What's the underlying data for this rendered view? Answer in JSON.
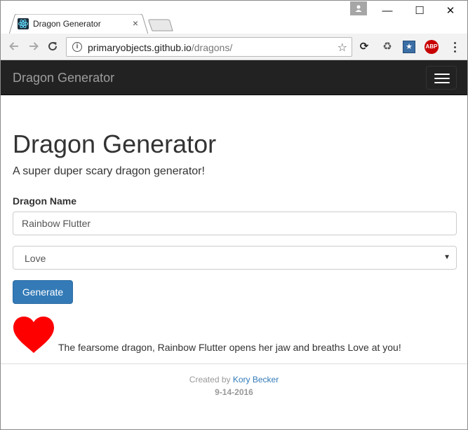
{
  "browser": {
    "tab_title": "Dragon Generator",
    "tab_close": "×",
    "url_host": "primaryobjects.github.io",
    "url_path": "/dragons/",
    "window_controls": {
      "minimize": "—",
      "maximize": "☐",
      "close": "✕"
    },
    "icons": {
      "back": "arrow-left-icon",
      "forward": "arrow-right-icon",
      "reload": "reload-icon",
      "info": "info-icon",
      "bookmark": "star-icon",
      "extensions": [
        "sync-icon",
        "recycle-icon",
        "bookmark-manager-icon",
        "adblock-icon"
      ],
      "menu": "more-vertical-icon"
    },
    "extension_abp_label": "ABP"
  },
  "navbar": {
    "brand": "Dragon Generator",
    "toggle_icon": "hamburger-icon",
    "background": "#222222"
  },
  "main": {
    "title": "Dragon Generator",
    "subtitle": "A super duper scary dragon generator!",
    "name_label": "Dragon Name",
    "name_value": "Rainbow Flutter",
    "breath_selected": "Love",
    "generate_label": "Generate",
    "result_text": "The fearsome dragon, Rainbow Flutter opens her jaw and breaths Love at you!",
    "result_icon": "heart-icon",
    "heart_color": "#ff0000",
    "button_color": "#337ab7"
  },
  "footer": {
    "created_by": "Created by",
    "author": "Kory Becker",
    "date": "9-14-2016"
  }
}
